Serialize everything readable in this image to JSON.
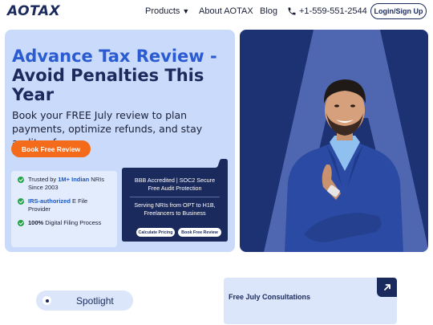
{
  "header": {
    "logo": "AOTAX",
    "nav": {
      "products": "Products",
      "about": "About AOTAX",
      "blog": "Blog",
      "phone": "+1-559-551-2544"
    },
    "login_label": "Login/Sign Up"
  },
  "hero": {
    "title_line1_highlight": "Advance Tax Review -",
    "title_rest": "Avoid Penalties This Year",
    "subtitle": "Book your FREE July review to plan payments, optimize refunds, and stay audit-safe.",
    "cta_label": "Book Free Review",
    "trust": {
      "item1_prefix": "Trusted by ",
      "item1_emphasis": "1M+ Indian",
      "item1_suffix": " NRIs Since 2003",
      "item2_emphasis": "IRS-authorized",
      "item2_suffix": "  E File Provider",
      "item3_bold": "100%",
      "item3_suffix": " Digital Filing Process"
    },
    "info": {
      "accredited": "BBB Accredited | SOC2 Secure",
      "protection": "Free Audit Protection",
      "serving": "Serving NRIs from OPT to H1B,",
      "freelancers": "Freelancers to Business",
      "calc_label": "Calculate Pricing",
      "book_label": "Book Free Review"
    },
    "image_icon": "businessman-photo"
  },
  "spotlight": {
    "label": "Spotlight"
  },
  "consult": {
    "title": "Free July Consultations",
    "icon": "arrow-up-right-icon"
  },
  "colors": {
    "brand_navy": "#1b2a5c",
    "accent_blue": "#2a5bd1",
    "cta_orange": "#f46b1b",
    "hero_bg": "#c9dafa",
    "check_green": "#22a447"
  }
}
